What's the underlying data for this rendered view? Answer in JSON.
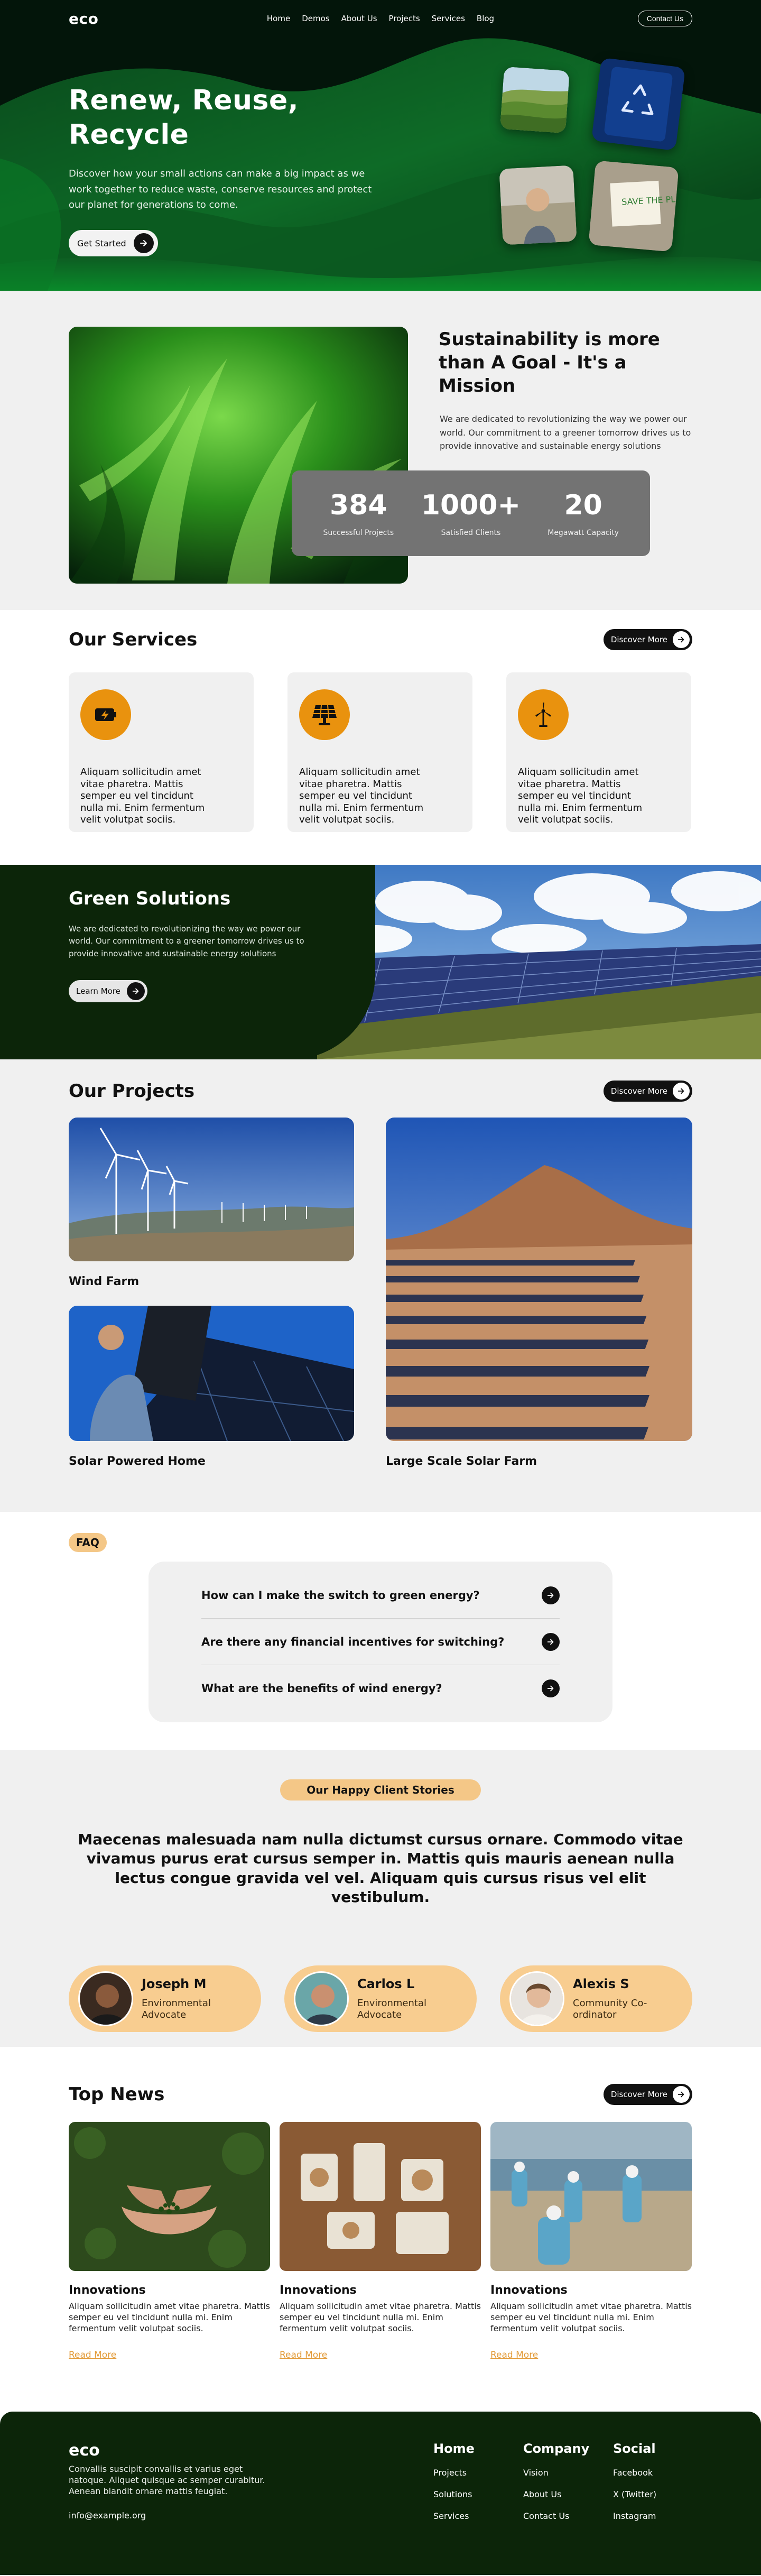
{
  "nav": {
    "logo": "eco",
    "links": [
      "Home",
      "Demos",
      "About Us",
      "Projects",
      "Services",
      "Blog"
    ],
    "contact": "Contact Us"
  },
  "hero": {
    "title": "Renew, Reuse, Recycle",
    "description": "Discover how your small actions can make a big impact as we work together to reduce waste, conserve resources and protect our planet for generations to come.",
    "cta": "Get Started",
    "note_text": "SAVE THE PLANET"
  },
  "sustain": {
    "title": "Sustainability is more than A Goal - It's a Mission",
    "description": "We are dedicated to revolutionizing the way we power our world. Our commitment to a greener tomorrow drives us to provide innovative and sustainable energy solutions",
    "stats": [
      {
        "num": "384",
        "label": "Successful Projects"
      },
      {
        "num": "1000+",
        "label": "Satisfied Clients"
      },
      {
        "num": "20",
        "label": "Megawatt Capacity"
      }
    ]
  },
  "services": {
    "title": "Our Services",
    "cta": "Discover More",
    "items": [
      {
        "icon": "battery-icon",
        "text": "Aliquam sollicitudin amet vitae pharetra. Mattis semper eu vel tincidunt nulla mi. Enim fermentum velit volutpat sociis."
      },
      {
        "icon": "solar-panel-icon",
        "text": "Aliquam sollicitudin amet vitae pharetra. Mattis semper eu vel tincidunt nulla mi. Enim fermentum velit volutpat sociis."
      },
      {
        "icon": "wind-turbine-icon",
        "text": "Aliquam sollicitudin amet vitae pharetra. Mattis semper eu vel tincidunt nulla mi. Enim fermentum velit volutpat sociis."
      }
    ]
  },
  "green": {
    "title": "Green Solutions",
    "description": "We are dedicated to revolutionizing the way we power our world. Our commitment to a greener tomorrow drives us to provide innovative and sustainable energy solutions",
    "cta": "Learn More"
  },
  "projects": {
    "title": "Our Projects",
    "cta": "Discover More",
    "items": [
      "Wind Farm",
      "Solar Powered Home",
      "Large Scale Solar Farm"
    ]
  },
  "faq": {
    "badge": "FAQ",
    "items": [
      "How can I make the switch to green energy?",
      "Are there any financial incentives for switching?",
      "What are the benefits of wind energy?"
    ]
  },
  "testimonials": {
    "badge": "Our Happy Client Stories",
    "quote": "Maecenas malesuada nam nulla dictumst cursus ornare. Commodo vitae vivamus purus erat cursus semper in. Mattis quis mauris aenean nulla lectus congue gravida vel vel. Aliquam quis cursus risus vel elit vestibulum.",
    "clients": [
      {
        "name": "Joseph M",
        "role": "Environmental Advocate"
      },
      {
        "name": "Carlos L",
        "role": "Environmental Advocate"
      },
      {
        "name": "Alexis S",
        "role": "Community Co-ordinator"
      }
    ]
  },
  "news": {
    "title": "Top News",
    "cta": "Discover More",
    "items": [
      {
        "title": "Innovations",
        "desc": "Aliquam sollicitudin amet vitae pharetra. Mattis semper eu vel tincidunt nulla mi. Enim fermentum velit volutpat sociis.",
        "link": "Read More"
      },
      {
        "title": "Innovations",
        "desc": "Aliquam sollicitudin amet vitae pharetra. Mattis semper eu vel tincidunt nulla mi. Enim fermentum velit volutpat sociis.",
        "link": "Read More"
      },
      {
        "title": "Innovations",
        "desc": "Aliquam sollicitudin amet vitae pharetra. Mattis semper eu vel tincidunt nulla mi. Enim fermentum velit volutpat sociis.",
        "link": "Read More"
      }
    ]
  },
  "footer": {
    "logo": "eco",
    "description": "Convallis suscipit convallis et varius eget natoque. Aliquet quisque ac semper curabitur. Aenean blandit ornare mattis feugiat.",
    "email": "info@example.org",
    "columns": [
      {
        "title": "Home",
        "links": [
          "Projects",
          "Solutions",
          "Services"
        ]
      },
      {
        "title": "Company",
        "links": [
          "Vision",
          "About Us",
          "Contact Us"
        ]
      },
      {
        "title": "Social",
        "links": [
          "Facebook",
          "X (Twitter)",
          "Instagram"
        ]
      }
    ]
  },
  "colors": {
    "accent_orange": "#e9920e",
    "badge_peach": "#f4c787",
    "dark_green": "#0c2509",
    "hero_green": "#0c6a25"
  }
}
